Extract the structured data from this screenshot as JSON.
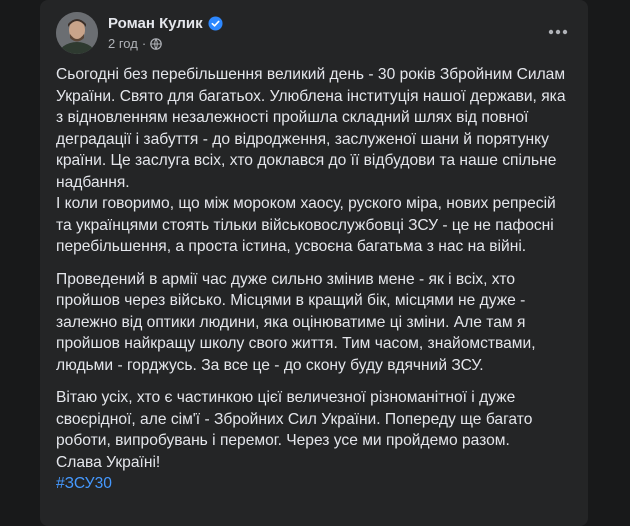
{
  "post": {
    "author": "Роман Кулик",
    "time": "2 год",
    "separator": "·",
    "paragraphs": [
      "Сьогодні без перебільшення великий день - 30 років Збройним Силам України. Свято для багатьох. Улюблена інституція нашої держави, яка з відновленням незалежності пройшла складний шлях від повної деградації і забуття - до відродження, заслуженої шани й порятунку країни. Це заслуга всіх, хто доклався до її відбудови та наше спільне надбання.\nІ коли говоримо, що між мороком хаосу, руского міра, нових репресій та українцями стоять тільки військовослужбовці ЗСУ - це не пафосні перебільшення, а проста істина, усвоєна багатьма з нас на війні.",
      "Проведений в армії час дуже сильно змінив мене - як і всіх, хто пройшов через військо. Місцями в кращий бік, місцями не дуже - залежно від оптики людини, яка оцінюватиме ці зміни. Але там я пройшов найкращу школу свого життя. Тим часом, знайомствами, людьми - горджусь. За все це - до скону буду вдячний ЗСУ.",
      "Вітаю усіх, хто є частинкою цієї величезної різноманітної і дуже своєрідної, але сім'ї - Збройних Сил України. Попереду ще багато роботи, випробувань і перемог. Через усе ми пройдемо разом.\nСлава Україні!"
    ],
    "hashtag": "#ЗСУ30"
  },
  "icons": {
    "verified": "verified-badge-icon",
    "audience": "globe-icon",
    "more": "more-horizontal-icon"
  },
  "colors": {
    "background": "#18191a",
    "card": "#242526",
    "text": "#e4e6eb",
    "secondary_text": "#b0b3b8",
    "link": "#4599ff",
    "verified": "#2d88ff"
  }
}
